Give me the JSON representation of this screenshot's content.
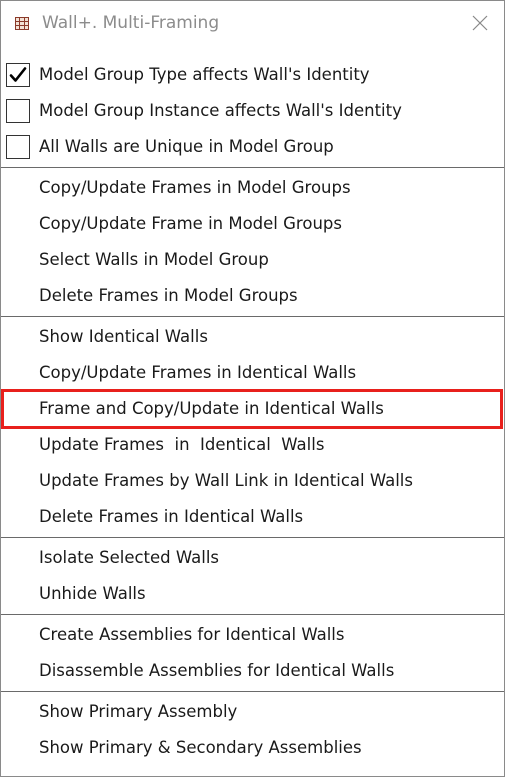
{
  "window": {
    "title": "Wall+. Multi-Framing",
    "icon": "framing-grid-icon",
    "close_icon": "close-icon",
    "highlight_color": "#e8201c"
  },
  "checkboxes": [
    {
      "label": "Model Group Type affects Wall's Identity",
      "checked": true
    },
    {
      "label": "Model Group Instance affects Wall's Identity",
      "checked": false
    },
    {
      "label": "All Walls are Unique in Model Group",
      "checked": false
    }
  ],
  "model_group_actions": [
    "Copy/Update Frames in Model Groups",
    "Copy/Update Frame in Model Groups",
    "Select Walls in Model Group",
    "Delete Frames in Model Groups"
  ],
  "identical_wall_actions": [
    "Show Identical Walls",
    "Copy/Update Frames in Identical Walls",
    "Frame and Copy/Update in Identical Walls",
    "Update Frames  in  Identical  Walls",
    "Update Frames by Wall Link in Identical Walls",
    "Delete Frames in Identical Walls"
  ],
  "visibility_actions": [
    "Isolate Selected Walls",
    "Unhide Walls"
  ],
  "assembly_actions": [
    "Create Assemblies for Identical Walls",
    "Disassemble Assemblies for Identical Walls"
  ],
  "primary_assembly_actions": [
    "Show Primary Assembly",
    "Show Primary & Secondary Assemblies"
  ]
}
